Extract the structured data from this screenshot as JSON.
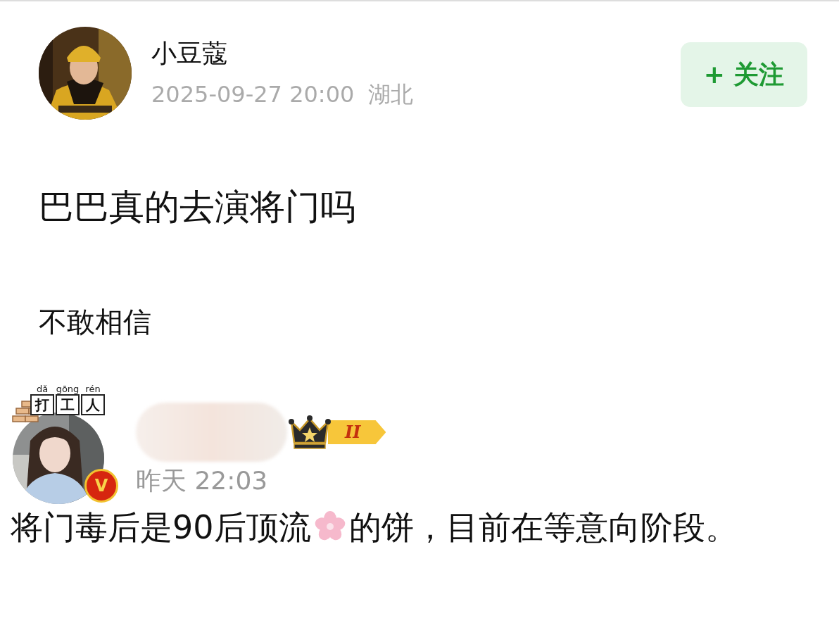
{
  "post": {
    "author": {
      "name": "小豆蔻"
    },
    "time": "2025-09-27 20:00",
    "location": "湖北",
    "follow_button": {
      "label": "+ 关注"
    },
    "title": "巴巴真的去演将门吗",
    "body": "不敢相信"
  },
  "comment": {
    "avatar_frame": {
      "pinyin": [
        "dǎ",
        "gōng",
        "rén"
      ],
      "characters": [
        "打",
        "工",
        "人"
      ]
    },
    "verified_badge": {
      "label": "V"
    },
    "level_badge": {
      "label": "II"
    },
    "time": "昨天 22:03",
    "text_before": "将门毒后是90后顶流",
    "text_after": "的饼，目前在等意向阶段。"
  }
}
